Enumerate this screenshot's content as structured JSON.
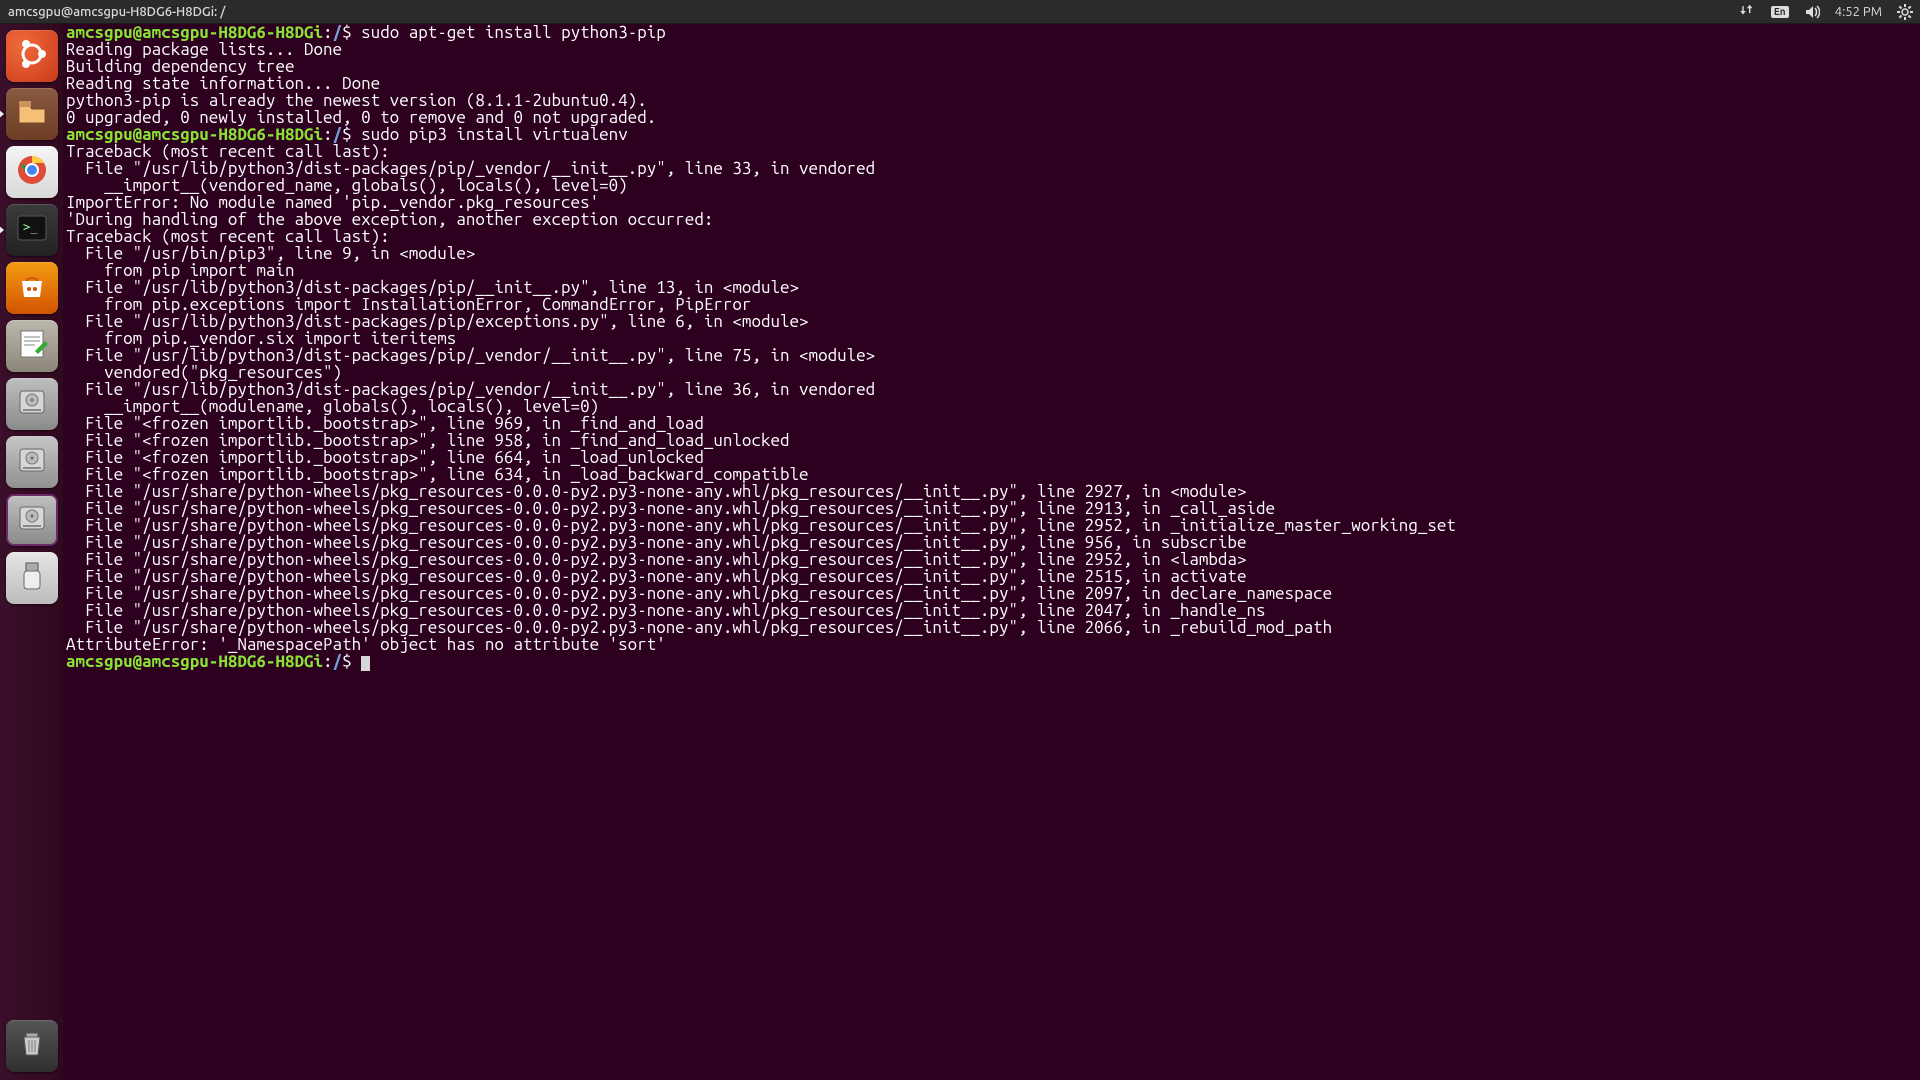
{
  "menubar": {
    "title": "amcsgpu@amcsgpu-H8DG6-H8DGi: /",
    "language_indicator": "En",
    "clock": "4:52 PM"
  },
  "launcher": {
    "items": [
      {
        "name": "dash",
        "icon": "ubuntu-dash-icon",
        "tileClass": "tile-dash",
        "running": false
      },
      {
        "name": "files",
        "icon": "folder-icon",
        "tileClass": "tile-files",
        "running": true
      },
      {
        "name": "google-chrome",
        "icon": "chrome-icon",
        "tileClass": "tile-chrome",
        "running": false
      },
      {
        "name": "terminal",
        "icon": "terminal-icon",
        "tileClass": "tile-term",
        "running": true
      },
      {
        "name": "ubuntu-software",
        "icon": "software-bag-icon",
        "tileClass": "tile-sw",
        "running": false
      },
      {
        "name": "text-editor",
        "icon": "text-editor-icon",
        "tileClass": "tile-text",
        "running": false
      },
      {
        "name": "disk-volume-1",
        "icon": "hdd-icon",
        "tileClass": "tile-hdd",
        "running": false
      },
      {
        "name": "disk-volume-2",
        "icon": "hdd-icon",
        "tileClass": "tile-hdd2",
        "running": false
      },
      {
        "name": "disk-volume-3",
        "icon": "hdd-icon",
        "tileClass": "tile-hdd3",
        "running": false
      },
      {
        "name": "usb-drive",
        "icon": "usb-drive-icon",
        "tileClass": "tile-usb",
        "running": false
      }
    ],
    "trash": {
      "name": "trash",
      "icon": "trash-icon",
      "tileClass": "tile-trash",
      "running": false
    }
  },
  "tray_icons": [
    "network-updown-icon",
    "language-indicator",
    "volume-icon",
    "clock",
    "gear-icon"
  ],
  "terminal": {
    "prompt": {
      "user_host": "amcsgpu@amcsgpu-H8DG6-H8DGi",
      "path": "/",
      "symbol": "$"
    },
    "lines": [
      {
        "t": "prompt",
        "cmd": "sudo apt-get install python3-pip"
      },
      {
        "t": "out",
        "text": "Reading package lists... Done"
      },
      {
        "t": "out",
        "text": "Building dependency tree       "
      },
      {
        "t": "out",
        "text": "Reading state information... Done"
      },
      {
        "t": "out",
        "text": "python3-pip is already the newest version (8.1.1-2ubuntu0.4)."
      },
      {
        "t": "out",
        "text": "0 upgraded, 0 newly installed, 0 to remove and 0 not upgraded."
      },
      {
        "t": "prompt",
        "cmd": "sudo pip3 install virtualenv"
      },
      {
        "t": "out",
        "text": "Traceback (most recent call last):"
      },
      {
        "t": "out",
        "text": "  File \"/usr/lib/python3/dist-packages/pip/_vendor/__init__.py\", line 33, in vendored"
      },
      {
        "t": "out",
        "text": "    __import__(vendored_name, globals(), locals(), level=0)"
      },
      {
        "t": "out",
        "text": "ImportError: No module named 'pip._vendor.pkg_resources'"
      },
      {
        "t": "out",
        "text": ""
      },
      {
        "t": "out",
        "text": "'During handling of the above exception, another exception occurred:"
      },
      {
        "t": "out",
        "text": ""
      },
      {
        "t": "out",
        "text": "Traceback (most recent call last):"
      },
      {
        "t": "out",
        "text": "  File \"/usr/bin/pip3\", line 9, in <module>"
      },
      {
        "t": "out",
        "text": "    from pip import main"
      },
      {
        "t": "out",
        "text": "  File \"/usr/lib/python3/dist-packages/pip/__init__.py\", line 13, in <module>"
      },
      {
        "t": "out",
        "text": "    from pip.exceptions import InstallationError, CommandError, PipError"
      },
      {
        "t": "out",
        "text": "  File \"/usr/lib/python3/dist-packages/pip/exceptions.py\", line 6, in <module>"
      },
      {
        "t": "out",
        "text": "    from pip._vendor.six import iteritems"
      },
      {
        "t": "out",
        "text": "  File \"/usr/lib/python3/dist-packages/pip/_vendor/__init__.py\", line 75, in <module>"
      },
      {
        "t": "out",
        "text": "    vendored(\"pkg_resources\")"
      },
      {
        "t": "out",
        "text": "  File \"/usr/lib/python3/dist-packages/pip/_vendor/__init__.py\", line 36, in vendored"
      },
      {
        "t": "out",
        "text": "    __import__(modulename, globals(), locals(), level=0)"
      },
      {
        "t": "out",
        "text": "  File \"<frozen importlib._bootstrap>\", line 969, in _find_and_load"
      },
      {
        "t": "out",
        "text": "  File \"<frozen importlib._bootstrap>\", line 958, in _find_and_load_unlocked"
      },
      {
        "t": "out",
        "text": "  File \"<frozen importlib._bootstrap>\", line 664, in _load_unlocked"
      },
      {
        "t": "out",
        "text": "  File \"<frozen importlib._bootstrap>\", line 634, in _load_backward_compatible"
      },
      {
        "t": "out",
        "text": "  File \"/usr/share/python-wheels/pkg_resources-0.0.0-py2.py3-none-any.whl/pkg_resources/__init__.py\", line 2927, in <module>"
      },
      {
        "t": "out",
        "text": "  File \"/usr/share/python-wheels/pkg_resources-0.0.0-py2.py3-none-any.whl/pkg_resources/__init__.py\", line 2913, in _call_aside"
      },
      {
        "t": "out",
        "text": "  File \"/usr/share/python-wheels/pkg_resources-0.0.0-py2.py3-none-any.whl/pkg_resources/__init__.py\", line 2952, in _initialize_master_working_set"
      },
      {
        "t": "out",
        "text": "  File \"/usr/share/python-wheels/pkg_resources-0.0.0-py2.py3-none-any.whl/pkg_resources/__init__.py\", line 956, in subscribe"
      },
      {
        "t": "out",
        "text": "  File \"/usr/share/python-wheels/pkg_resources-0.0.0-py2.py3-none-any.whl/pkg_resources/__init__.py\", line 2952, in <lambda>"
      },
      {
        "t": "out",
        "text": "  File \"/usr/share/python-wheels/pkg_resources-0.0.0-py2.py3-none-any.whl/pkg_resources/__init__.py\", line 2515, in activate"
      },
      {
        "t": "out",
        "text": "  File \"/usr/share/python-wheels/pkg_resources-0.0.0-py2.py3-none-any.whl/pkg_resources/__init__.py\", line 2097, in declare_namespace"
      },
      {
        "t": "out",
        "text": "  File \"/usr/share/python-wheels/pkg_resources-0.0.0-py2.py3-none-any.whl/pkg_resources/__init__.py\", line 2047, in _handle_ns"
      },
      {
        "t": "out",
        "text": "  File \"/usr/share/python-wheels/pkg_resources-0.0.0-py2.py3-none-any.whl/pkg_resources/__init__.py\", line 2066, in _rebuild_mod_path"
      },
      {
        "t": "out",
        "text": "AttributeError: '_NamespacePath' object has no attribute 'sort'"
      },
      {
        "t": "prompt",
        "cmd": "",
        "cursor": true
      }
    ]
  }
}
